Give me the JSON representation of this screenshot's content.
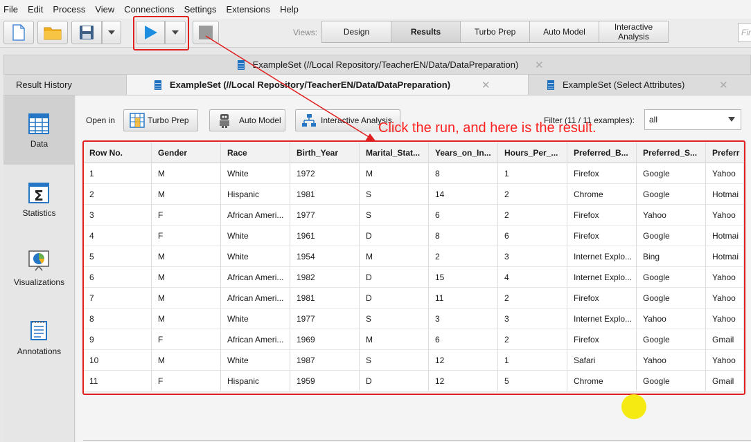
{
  "menu": [
    "File",
    "Edit",
    "Process",
    "View",
    "Connections",
    "Settings",
    "Extensions",
    "Help"
  ],
  "toolbar": {
    "views_label": "Views:",
    "views": [
      "Design",
      "Results",
      "Turbo Prep",
      "Auto Model",
      "Interactive\nAnalysis"
    ],
    "active_view": "Results",
    "search_placeholder": "Fir"
  },
  "tabs": {
    "top_row": "ExampleSet (//Local Repository/TeacherEN/Data/DataPreparation)",
    "result_history": "Result History",
    "active": "ExampleSet (//Local Repository/TeacherEN/Data/DataPreparation)",
    "third": "ExampleSet (Select Attributes)",
    "close_glyph": "✕"
  },
  "sidebar": {
    "items": [
      {
        "label": "Data",
        "icon": "table-icon",
        "active": true
      },
      {
        "label": "Statistics",
        "icon": "statistics-icon",
        "active": false
      },
      {
        "label": "Visualizations",
        "icon": "visualizations-icon",
        "active": false
      },
      {
        "label": "Annotations",
        "icon": "annotations-icon",
        "active": false
      }
    ]
  },
  "open_in": {
    "label": "Open in",
    "buttons": [
      "Turbo Prep",
      "Auto Model",
      "Interactive Analysis"
    ]
  },
  "filter": {
    "label": "Filter (11 / 11 examples):",
    "value": "all"
  },
  "table": {
    "columns": [
      "Row No.",
      "Gender",
      "Race",
      "Birth_Year",
      "Marital_Stat...",
      "Years_on_In...",
      "Hours_Per_...",
      "Preferred_B...",
      "Preferred_S...",
      "Preferr"
    ],
    "rows": [
      [
        "1",
        "M",
        "White",
        "1972",
        "M",
        "8",
        "1",
        "Firefox",
        "Google",
        "Yahoo"
      ],
      [
        "2",
        "M",
        "Hispanic",
        "1981",
        "S",
        "14",
        "2",
        "Chrome",
        "Google",
        "Hotmai"
      ],
      [
        "3",
        "F",
        "African Ameri...",
        "1977",
        "S",
        "6",
        "2",
        "Firefox",
        "Yahoo",
        "Yahoo"
      ],
      [
        "4",
        "F",
        "White",
        "1961",
        "D",
        "8",
        "6",
        "Firefox",
        "Google",
        "Hotmai"
      ],
      [
        "5",
        "M",
        "White",
        "1954",
        "M",
        "2",
        "3",
        "Internet Explo...",
        "Bing",
        "Hotmai"
      ],
      [
        "6",
        "M",
        "African Ameri...",
        "1982",
        "D",
        "15",
        "4",
        "Internet Explo...",
        "Google",
        "Yahoo"
      ],
      [
        "7",
        "M",
        "African Ameri...",
        "1981",
        "D",
        "11",
        "2",
        "Firefox",
        "Google",
        "Yahoo"
      ],
      [
        "8",
        "M",
        "White",
        "1977",
        "S",
        "3",
        "3",
        "Internet Explo...",
        "Yahoo",
        "Yahoo"
      ],
      [
        "9",
        "F",
        "African Ameri...",
        "1969",
        "M",
        "6",
        "2",
        "Firefox",
        "Google",
        "Gmail"
      ],
      [
        "10",
        "M",
        "White",
        "1987",
        "S",
        "12",
        "1",
        "Safari",
        "Yahoo",
        "Yahoo"
      ],
      [
        "11",
        "F",
        "Hispanic",
        "1959",
        "D",
        "12",
        "5",
        "Chrome",
        "Google",
        "Gmail"
      ]
    ]
  },
  "annotation": {
    "text": "Click the run, and here is the result.",
    "color": "#ff2020"
  }
}
